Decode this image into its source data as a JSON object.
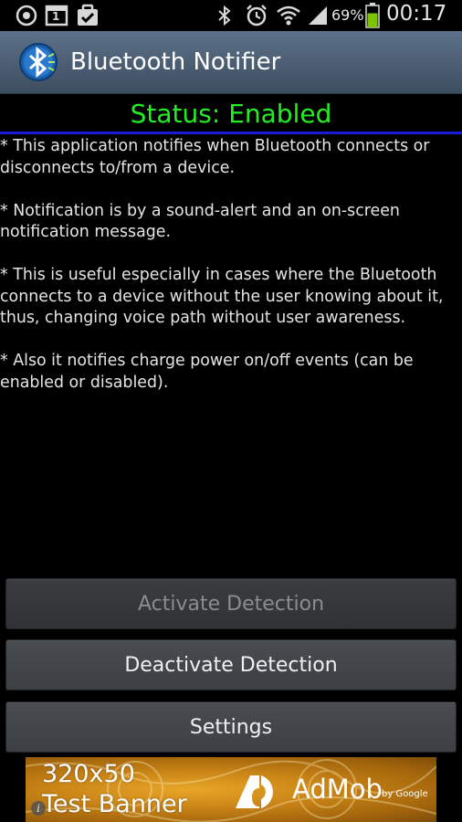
{
  "status_bar": {
    "icons": [
      "sync-circle-icon",
      "calendar-icon",
      "clipboard-check-icon",
      "bluetooth-icon",
      "alarm-icon",
      "wifi-icon",
      "signal-icon",
      "battery-icon"
    ],
    "calendar_day": "1",
    "battery_percent": "69%",
    "clock": "00:17",
    "battery_color": "#7dc400"
  },
  "app": {
    "title": "Bluetooth Notifier",
    "icon": "bluetooth-app-icon"
  },
  "status": {
    "text": "Status: Enabled",
    "color": "#22ee22",
    "divider_color": "#1a1adc"
  },
  "description": [
    "* This application notifies when Bluetooth connects or disconnects to/from a device.",
    "* Notification is by a sound-alert and an on-screen notification message.",
    "* This is useful especially in cases where the Bluetooth connects to a device without the user knowing about it, thus, changing voice path without user awareness.",
    "* Also it notifies charge power on/off events (can be enabled or disabled)."
  ],
  "buttons": {
    "activate": "Activate Detection",
    "deactivate": "Deactivate Detection",
    "settings": "Settings"
  },
  "ad": {
    "size": "320x50",
    "label": "Test Banner",
    "brand": "AdMob",
    "byline": "by Google",
    "info": "i"
  }
}
